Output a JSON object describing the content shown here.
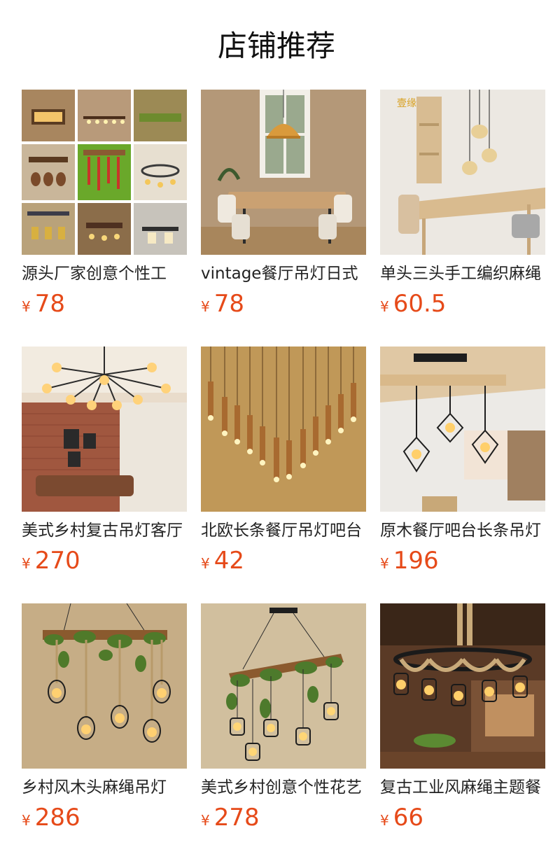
{
  "page": {
    "title": "店铺推荐"
  },
  "colors": {
    "price": "#e64a19",
    "text": "#222222",
    "background": "#ffffff"
  },
  "products": [
    {
      "name": "源头厂家创意个性工",
      "currency": "¥",
      "price": "78",
      "image": "collage-of-nine-rustic-pendant-lamps"
    },
    {
      "name": "vintage餐厅吊灯日式",
      "currency": "¥",
      "price": "78",
      "image": "dining-room-wooden-dome-pendant"
    },
    {
      "name": "单头三头手工编织麻绳",
      "currency": "¥",
      "price": "60.5",
      "image": "three-woven-rattan-pendants-over-table"
    },
    {
      "name": "美式乡村复古吊灯客厅",
      "currency": "¥",
      "price": "270",
      "image": "sputnik-chandelier-brick-living-room"
    },
    {
      "name": "北欧长条餐厅吊灯吧台",
      "currency": "¥",
      "price": "42",
      "image": "long-wooden-tube-pendants"
    },
    {
      "name": "原木餐厅吧台长条吊灯",
      "currency": "¥",
      "price": "196",
      "image": "wood-beam-cage-pendants"
    },
    {
      "name": "乡村风木头麻绳吊灯",
      "currency": "¥",
      "price": "286",
      "image": "wood-rope-vine-cage-chandelier"
    },
    {
      "name": "美式乡村创意个性花艺",
      "currency": "¥",
      "price": "278",
      "image": "vine-wood-beam-cage-chandelier"
    },
    {
      "name": "复古工业风麻绳主题餐",
      "currency": "¥",
      "price": "66",
      "image": "rope-ring-industrial-chandelier"
    }
  ]
}
